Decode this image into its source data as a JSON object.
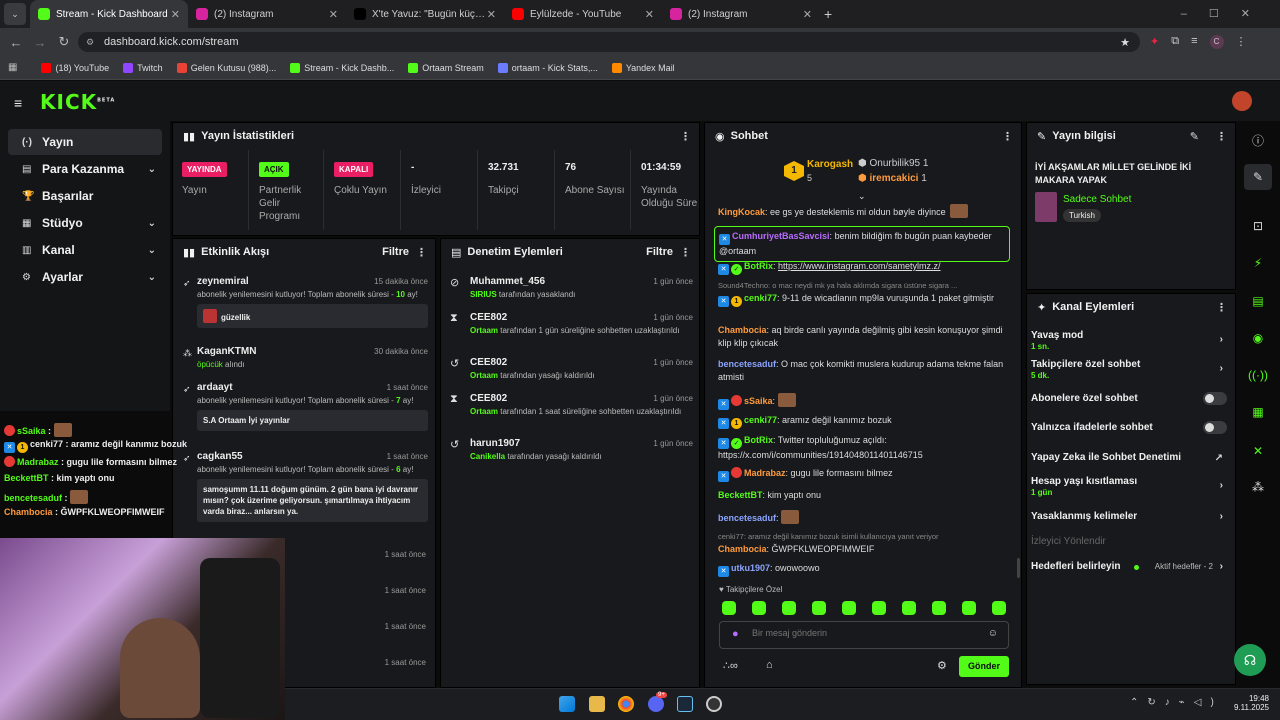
{
  "browser": {
    "tabs": [
      {
        "title": "Stream - Kick Dashboard",
        "color": "#53fc18",
        "active": true
      },
      {
        "title": "(2) Instagram",
        "color": "#d6249f"
      },
      {
        "title": "X'te Yavuz: \"Bugün küçük bir ya",
        "color": "#000000"
      },
      {
        "title": "Eylülzede - YouTube",
        "color": "#ff0000"
      },
      {
        "title": "(2) Instagram",
        "color": "#d6249f"
      }
    ],
    "url": "dashboard.kick.com/stream",
    "bookmarks": [
      {
        "label": "(18) YouTube",
        "color": "#ff0000"
      },
      {
        "label": "Twitch",
        "color": "#9146ff"
      },
      {
        "label": "Gelen Kutusu (988)...",
        "color": "#ea4335"
      },
      {
        "label": "Stream - Kick Dashb...",
        "color": "#53fc18"
      },
      {
        "label": "Ortaam Stream",
        "color": "#53fc18"
      },
      {
        "label": "ortaam - Kick Stats,...",
        "color": "#6c7cff"
      },
      {
        "label": "Yandex Mail",
        "color": "#ff8a00"
      }
    ],
    "profile_initial": "C"
  },
  "kick": {
    "logo": "KICK",
    "logo_sup": "BETA",
    "accent": "#53fc18"
  },
  "sidebar": [
    {
      "label": "Yayın",
      "icon": "(·)"
    },
    {
      "label": "Para Kazanma",
      "icon": "▤"
    },
    {
      "label": "Başarılar",
      "icon": "🏆"
    },
    {
      "label": "Stüdyo",
      "icon": "▦"
    },
    {
      "label": "Kanal",
      "icon": "▥"
    },
    {
      "label": "Ayarlar",
      "icon": "⚙"
    }
  ],
  "stats": {
    "title": "Yayın İstatistikleri",
    "cols": [
      {
        "pill": "YAYINDA",
        "pill_bg": "#e91e63",
        "label": "Yayın"
      },
      {
        "pill": "AÇIK",
        "pill_bg": "#53fc18",
        "label": "Partnerlik Gelir Programı"
      },
      {
        "pill": "KAPALI",
        "pill_bg": "#e91e63",
        "label": "Çoklu Yayın"
      },
      {
        "value": "-",
        "label": "İzleyici"
      },
      {
        "value": "32.731",
        "label": "Takipçi"
      },
      {
        "value": "76",
        "label": "Abone Sayısı"
      },
      {
        "value": "01:34:59",
        "label": "Yayında Olduğu Süre"
      }
    ]
  },
  "events": {
    "title": "Etkinlik Akışı",
    "filter": "Filtre",
    "items": [
      {
        "name": "zeynemiral",
        "time": "15 dakika önce",
        "desc": "abonelik yenilemesini kutluyor! Toplam abonelik süresi - ",
        "months": "10",
        "suffix": " ay!",
        "box": "güzellik"
      },
      {
        "name": "KaganKTMN",
        "time": "30 dakika önce",
        "desc_green": "öpücük",
        "desc": " alındı"
      },
      {
        "name": "ardaayt",
        "time": "1 saat önce",
        "desc": "abonelik yenilemesini kutluyor! Toplam abonelik süresi - ",
        "months": "7",
        "suffix": " ay!",
        "box": "S.A Ortaam İyi yayınlar"
      },
      {
        "name": "cagkan55",
        "time": "1 saat önce",
        "desc": "abonelik yenilemesini kutluyor! Toplam abonelik süresi - ",
        "months": "6",
        "suffix": " ay!",
        "box": "samoşumm 11.11 doğum günüm. 2 gün bana iyi davranır mısın? çok üzerime geliyorsun. şımartılmaya ihtiyacım varda biraz... anlarsın ya."
      }
    ],
    "more_times": [
      "1 saat önce",
      "1 saat önce",
      "1 saat önce",
      "1 saat önce"
    ]
  },
  "moderation": {
    "title": "Denetim Eylemleri",
    "filter": "Filtre",
    "items": [
      {
        "name": "Muhammet_456",
        "time": "1 gün önce",
        "actor": "SIRIUS",
        "desc": " tarafından yasaklandı"
      },
      {
        "name": "CEE802",
        "time": "1 gün önce",
        "actor": "Ortaam",
        "desc": " tarafından 1 gün süreliğine sohbetten uzaklaştırıldı"
      },
      {
        "name": "CEE802",
        "time": "1 gün önce",
        "actor": "Ortaam",
        "desc": " tarafından yasağı kaldırıldı"
      },
      {
        "name": "CEE802",
        "time": "1 gün önce",
        "actor": "Ortaam",
        "desc": " tarafından 1 saat süreliğine sohbetten uzaklaştırıldı"
      },
      {
        "name": "harun1907",
        "time": "1 gün önce",
        "actor": "Canikella",
        "desc": " tarafından yasağı kaldırıldı"
      }
    ]
  },
  "chat": {
    "title": "Sohbet",
    "leader": {
      "first": "Karogash",
      "first_count": "5",
      "second": "Onurbilik95",
      "second_count": "1",
      "third": "iremcakici",
      "third_count": "1"
    },
    "messages": [
      {
        "user": "KingKocak",
        "color": "#ff9b3d",
        "text": "ee gs ye desteklemis mi oldun bøyle diyince"
      },
      {
        "user": "CumhuriyetBasSavcisi",
        "color": "#b76cff",
        "text": "benim bildiğim fb bugün puan kaybeder @ortaam"
      },
      {
        "user": "BotRix",
        "color": "#53fc18",
        "text": "https://www.instagram.com/sametylmz.z/"
      },
      {
        "reply": "Sound4Techno: o mac neydi mk ya hala aklımda sigara üstüne sigara ...",
        "user": "cenki77",
        "color": "#53fc18",
        "text": "9-11 de wicadianın mp9la vuruşunda 1 paket gitmiştir"
      },
      {
        "user": "Chambocia",
        "color": "#ff9b3d",
        "text": "aq birde canlı yayında değilmiş gibi kesin konuşuyor şimdi klip klip çıkıcak"
      },
      {
        "user": "bencetesaduf",
        "color": "#8aa4ff",
        "text": "O mac çok komikti muslera kudurup adama tekme falan atmisti"
      },
      {
        "user": "sSaika",
        "color": "#ff9b3d",
        "text": ""
      },
      {
        "user": "cenki77",
        "color": "#53fc18",
        "text": "aramız değil kanımız bozuk"
      },
      {
        "user": "BotRix",
        "color": "#53fc18",
        "text": "Twitter topluluğumuz açıldı: https://x.com/i/communities/1914048011401146715"
      },
      {
        "user": "Madrabaz",
        "color": "#ff9b3d",
        "text": "gugu lile formasını bilmez"
      },
      {
        "user": "BeckettBT",
        "color": "#53fc18",
        "text": "kim yaptı onu"
      },
      {
        "user": "bencetesaduf",
        "color": "#8aa4ff",
        "text": ""
      },
      {
        "reply": "cenki77: aramız değil kanımız bozuk isimli kullanıcıya yanıt veriyor",
        "user": "Chambocia",
        "color": "#ff9b3d",
        "text": "ĞWPFKLWEOPFIMWEIF"
      },
      {
        "user": "utku1907",
        "color": "#8aa4ff",
        "text": "owowoowo"
      }
    ],
    "followers_only": "Takipçilere Özel",
    "placeholder": "Bir mesaj gönderin",
    "send": "Gönder"
  },
  "stream_info": {
    "title": "Yayın bilgisi",
    "stream_title": "İYİ AKŞAMLAR MİLLET GELİNDE İKİ MAKARA YAPAK",
    "category": "Sadece Sohbet",
    "tag": "Turkish"
  },
  "channel_actions": {
    "title": "Kanal Eylemleri",
    "items": [
      {
        "label": "Yavaş mod",
        "sub": "1 sn.",
        "ctrl": "chev"
      },
      {
        "label": "Takipçilere özel sohbet",
        "sub": "5 dk.",
        "ctrl": "chev"
      },
      {
        "label": "Abonelere özel sohbet",
        "ctrl": "toggle"
      },
      {
        "label": "Yalnızca ifadelerle sohbet",
        "ctrl": "toggle"
      },
      {
        "label": "Yapay Zeka ile Sohbet Denetimi",
        "ctrl": "ext"
      },
      {
        "label": "Hesap yaşı kısıtlaması",
        "sub": "1 gün",
        "ctrl": "chev"
      },
      {
        "label": "Yasaklanmış kelimeler",
        "ctrl": "chev"
      },
      {
        "label": "İzleyici Yönlendir",
        "ctrl": "none",
        "dim": true
      },
      {
        "label": "Hedefleri belirleyin",
        "ctrl": "chev",
        "right": "Aktif hedefler - 2"
      }
    ]
  },
  "overlay_chat": [
    {
      "user": "sSaika",
      "color": "#53fc18",
      "text": ""
    },
    {
      "user": "cenki77",
      "color": "#eee",
      "text": "aramız değil kanımız bozuk"
    },
    {
      "user": "Madrabaz",
      "color": "#53fc18",
      "text": "gugu lile formasını bilmez"
    },
    {
      "user": "BeckettBT",
      "color": "#53fc18",
      "text": "kim yaptı onu"
    },
    {
      "user": "bencetesaduf",
      "color": "#53fc18",
      "text": ""
    },
    {
      "user": "Chambocia",
      "color": "#ff9b3d",
      "text": "ĞWPFKLWEOPFIMWEIF"
    }
  ],
  "taskbar": {
    "time": "19:48",
    "date": "9.11.2025",
    "badge": "9+"
  }
}
